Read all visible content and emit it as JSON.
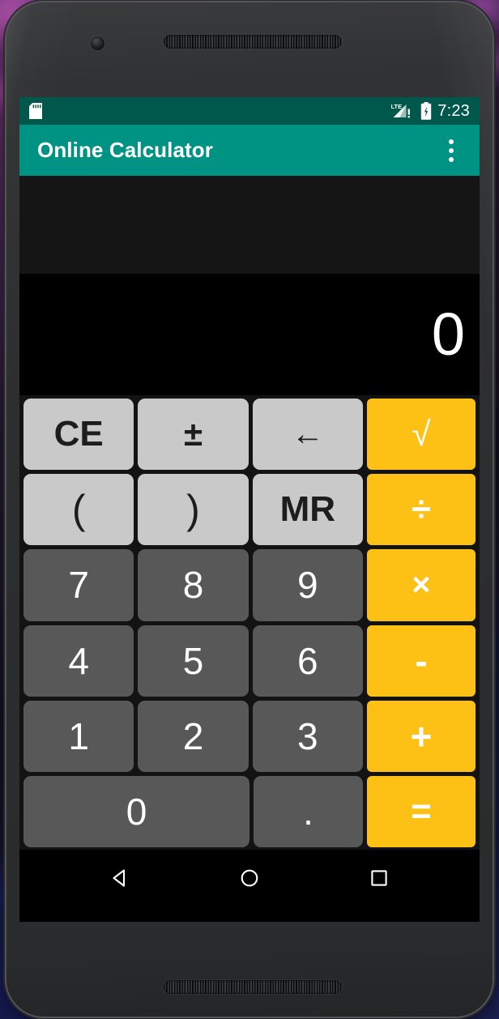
{
  "device": {
    "frame": "android-phone",
    "camera_icon": "front-camera-icon",
    "earpiece_icon": "earpiece-speaker-grille",
    "bottom_speaker_icon": "bottom-speaker-grille"
  },
  "status_bar": {
    "sd_card_icon": "sd-card-icon",
    "signal_icon": "lte-signal-warning-icon",
    "signal_label": "LTE",
    "battery_icon": "battery-charging-icon",
    "clock": "7:23",
    "background_color": "#00584c"
  },
  "app_bar": {
    "title": "Online Calculator",
    "overflow_icon": "overflow-menu-icon",
    "background_color": "#009384",
    "text_color": "#ffffff"
  },
  "display": {
    "expression": "",
    "result": "0",
    "expression_background": "#151515",
    "result_background": "#000000",
    "result_color": "#ffffff"
  },
  "theme": {
    "accent_color": "#fdc014",
    "light_key_color": "#c9c9c9",
    "number_key_color": "#585858",
    "keypad_background": "#131313"
  },
  "keypad": {
    "rows": [
      [
        {
          "label": "CE",
          "name": "key-clear-entry",
          "style": "light",
          "extra": "ce"
        },
        {
          "label": "±",
          "name": "key-plus-minus",
          "style": "light",
          "extra": "plusminus"
        },
        {
          "label": "←",
          "name": "key-backspace",
          "style": "light",
          "extra": "arrow"
        },
        {
          "label": "√",
          "name": "key-square-root",
          "style": "accent",
          "extra": "op-sqrt"
        }
      ],
      [
        {
          "label": "(",
          "name": "key-open-paren",
          "style": "light",
          "extra": "paren"
        },
        {
          "label": ")",
          "name": "key-close-paren",
          "style": "light",
          "extra": "paren"
        },
        {
          "label": "MR",
          "name": "key-memory-recall",
          "style": "light",
          "extra": "mr"
        },
        {
          "label": "÷",
          "name": "key-divide",
          "style": "accent",
          "extra": "op-div"
        }
      ],
      [
        {
          "label": "7",
          "name": "key-7",
          "style": "num",
          "extra": ""
        },
        {
          "label": "8",
          "name": "key-8",
          "style": "num",
          "extra": ""
        },
        {
          "label": "9",
          "name": "key-9",
          "style": "num",
          "extra": ""
        },
        {
          "label": "×",
          "name": "key-multiply",
          "style": "accent",
          "extra": "op-times"
        }
      ],
      [
        {
          "label": "4",
          "name": "key-4",
          "style": "num",
          "extra": ""
        },
        {
          "label": "5",
          "name": "key-5",
          "style": "num",
          "extra": ""
        },
        {
          "label": "6",
          "name": "key-6",
          "style": "num",
          "extra": ""
        },
        {
          "label": "-",
          "name": "key-subtract",
          "style": "accent",
          "extra": "op-minus"
        }
      ],
      [
        {
          "label": "1",
          "name": "key-1",
          "style": "num",
          "extra": ""
        },
        {
          "label": "2",
          "name": "key-2",
          "style": "num",
          "extra": ""
        },
        {
          "label": "3",
          "name": "key-3",
          "style": "num",
          "extra": ""
        },
        {
          "label": "+",
          "name": "key-add",
          "style": "accent",
          "extra": "op-plus"
        }
      ],
      [
        {
          "label": "0",
          "name": "key-0",
          "style": "num",
          "extra": "zero"
        },
        {
          "label": ".",
          "name": "key-decimal-point",
          "style": "num",
          "extra": "dot"
        },
        {
          "label": "=",
          "name": "key-equals",
          "style": "accent",
          "extra": "op-eq"
        }
      ]
    ]
  },
  "nav_bar": {
    "back_icon": "back-triangle-icon",
    "home_icon": "home-circle-icon",
    "recents_icon": "recents-square-icon",
    "background_color": "#000000"
  }
}
